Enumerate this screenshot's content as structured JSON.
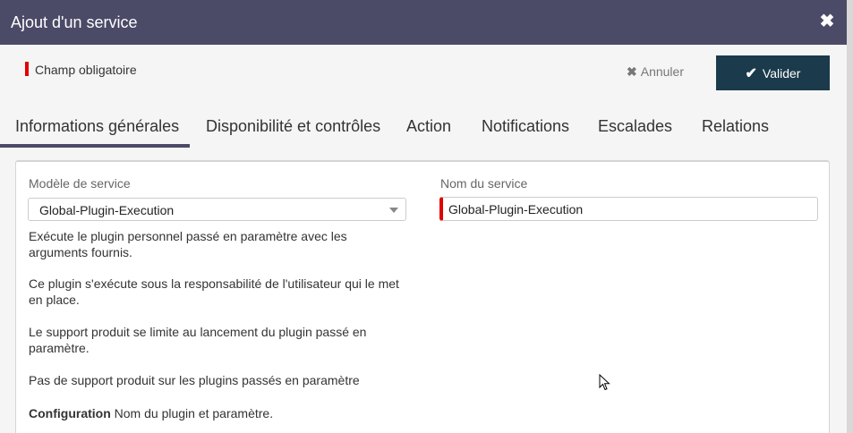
{
  "dialog": {
    "title": "Ajout d'un service",
    "close_glyph": "✖"
  },
  "header": {
    "required_label": "Champ obligatoire",
    "cancel_label": "Annuler",
    "cancel_glyph": "✖",
    "validate_label": "Valider",
    "validate_glyph": "✔"
  },
  "tabs": [
    {
      "label": "Informations générales",
      "active": true
    },
    {
      "label": "Disponibilité et contrôles"
    },
    {
      "label": "Action"
    },
    {
      "label": "Notifications"
    },
    {
      "label": "Escalades"
    },
    {
      "label": "Relations"
    }
  ],
  "form": {
    "template_label": "Modèle de service",
    "template_value": "Global-Plugin-Execution",
    "name_label": "Nom du service",
    "name_value": "Global-Plugin-Execution",
    "description": [
      "Exécute le plugin personnel passé en paramètre avec les arguments fournis.",
      "Ce plugin s'exécute sous la responsabilité de l'utilisateur qui le met en place.",
      "Le support produit se limite au lancement du plugin passé en paramètre.",
      "Pas de support produit sur les plugins passés en paramètre"
    ],
    "configuration_label": "Configuration",
    "configuration_text": " Nom du plugin et paramètre."
  },
  "colors": {
    "titlebar": "#4b4a67",
    "validate_button": "#1b3a4b",
    "required_marker": "#e00000"
  }
}
